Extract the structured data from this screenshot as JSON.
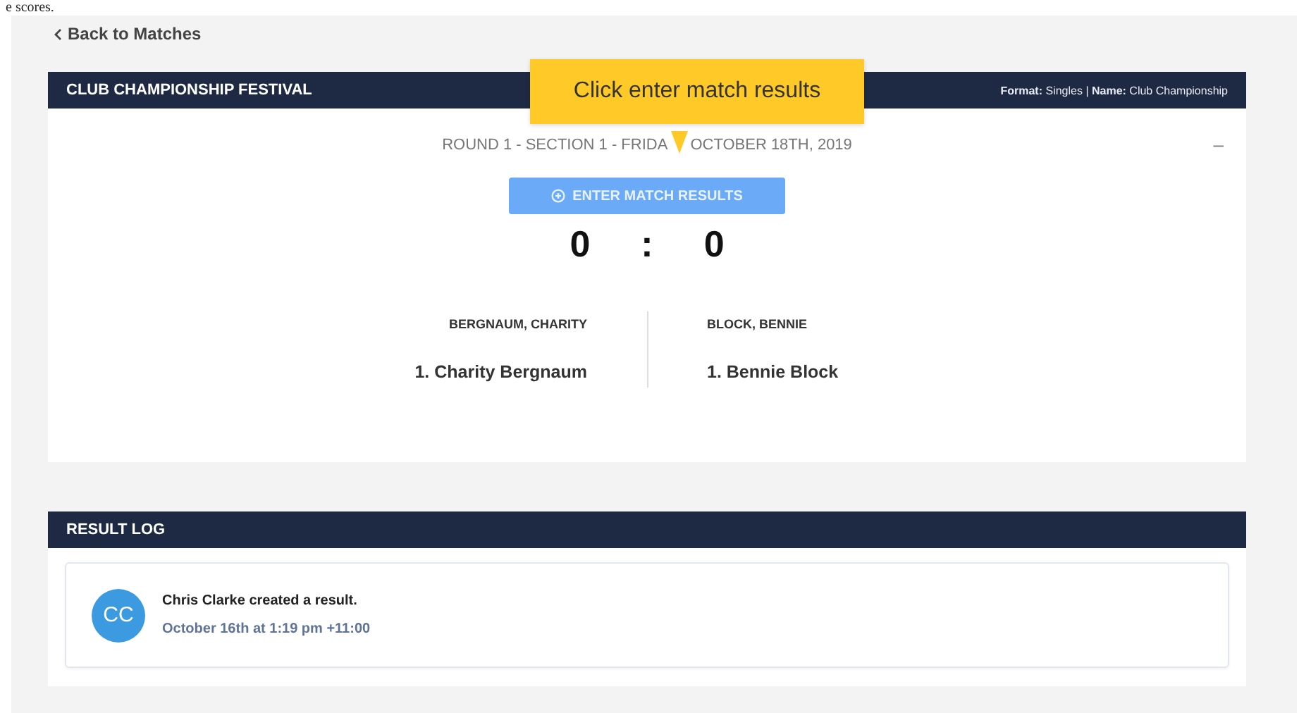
{
  "caption": "e scores.",
  "back_link": {
    "label": "Back to Matches"
  },
  "match_panel": {
    "title": "CLUB CHAMPIONSHIP FESTIVAL",
    "meta": "**Format:** Singles | **Name:** Club Championship",
    "round_before": "ROUND 1 - SECTION 1 - FRIDA",
    "round_after": "OCTOBER 18TH, 2019",
    "collapse_toggle": "–",
    "action_button": {
      "label": "ENTER MATCH RESULTS"
    },
    "score": {
      "home": "0",
      "separator": ":",
      "away": "0"
    },
    "sides": [
      {
        "name": "BERGNAUM, CHARITY",
        "players": [
          "1. Charity Bergnaum"
        ]
      },
      {
        "name": "BLOCK, BENNIE",
        "players": [
          "1. Bennie Block"
        ]
      }
    ]
  },
  "tooltip": {
    "text": "Click enter match results"
  },
  "result_log": {
    "title": "RESULT LOG",
    "entries": [
      {
        "initials": "CC",
        "message": "Chris Clarke created a result.",
        "time": "October 16th at 1:19 pm +11:00"
      }
    ]
  }
}
